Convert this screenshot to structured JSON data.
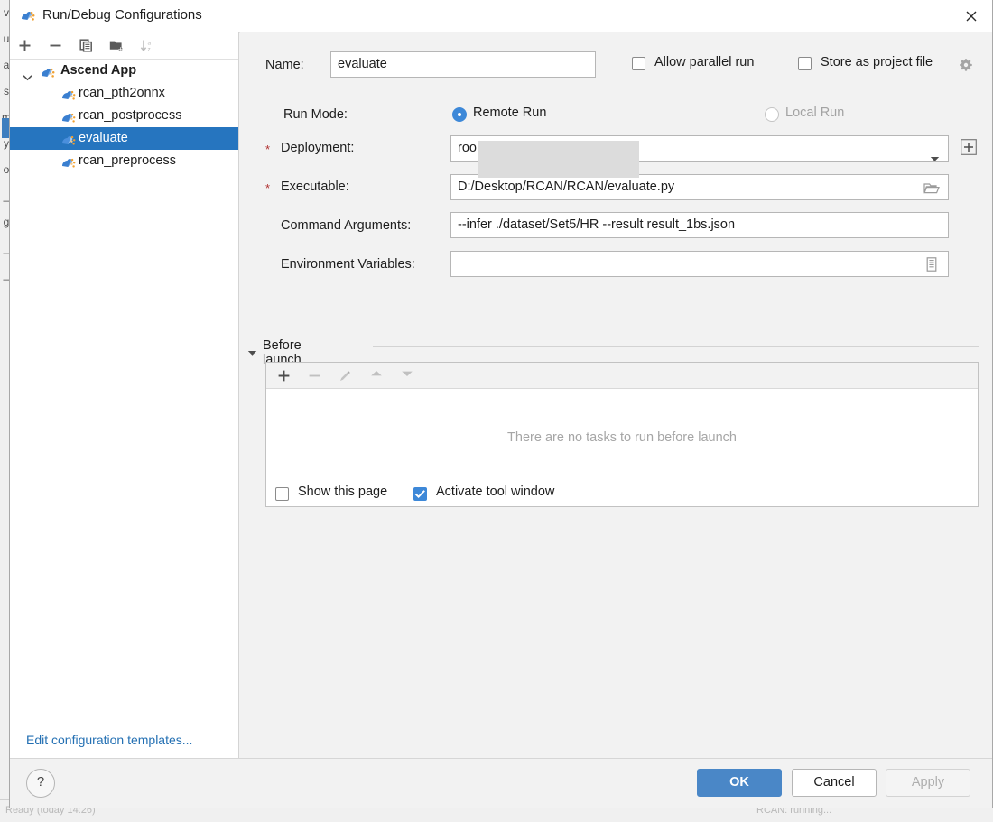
{
  "background": {
    "left_strip_chars": [
      "v",
      "u",
      "a",
      "s",
      "m",
      "y",
      "o",
      "_",
      "g",
      "_",
      "_"
    ],
    "status_left": "Ready (today 14:26)",
    "status_right": "RCAN: running..."
  },
  "dialog": {
    "title": "Run/Debug Configurations",
    "title_icon": "ascend-app-icon",
    "close_icon": "close-icon"
  },
  "sidebar": {
    "toolbar": [
      {
        "name": "add-configuration-button",
        "icon": "plus-icon",
        "enabled": true
      },
      {
        "name": "remove-configuration-button",
        "icon": "minus-icon",
        "enabled": true
      },
      {
        "name": "copy-configuration-button",
        "icon": "copy-icon",
        "enabled": true
      },
      {
        "name": "new-folder-button",
        "icon": "new-folder-icon",
        "enabled": true
      },
      {
        "name": "sort-configurations-button",
        "icon": "sort-alphabetical-icon",
        "enabled": false
      }
    ],
    "tree": {
      "group": {
        "label": "Ascend App",
        "expanded": true,
        "icon": "ascend-app-icon"
      },
      "children": [
        {
          "label": "rcan_pth2onnx",
          "selected": false,
          "icon": "ascend-app-icon"
        },
        {
          "label": "rcan_postprocess",
          "selected": false,
          "icon": "ascend-app-icon"
        },
        {
          "label": "evaluate",
          "selected": true,
          "icon": "ascend-app-icon"
        },
        {
          "label": "rcan_preprocess",
          "selected": false,
          "icon": "ascend-app-icon"
        }
      ]
    },
    "edit_templates_link": "Edit configuration templates..."
  },
  "form": {
    "name_label": "Name:",
    "name_value": "evaluate",
    "allow_parallel_run": {
      "label": "Allow parallel run",
      "checked": false
    },
    "store_as_project_file": {
      "label": "Store as project file",
      "checked": false,
      "gear_icon": "gear-dropdown-icon"
    },
    "run_mode_label": "Run Mode:",
    "remote_run": {
      "label": "Remote Run",
      "selected": true,
      "enabled": true
    },
    "local_run": {
      "label": "Local Run",
      "selected": false,
      "enabled": false
    },
    "deployment_label": "Deployment:",
    "deployment_value": "roo",
    "deployment_required": true,
    "deployment_add_icon": "add-box-icon",
    "executable_label": "Executable:",
    "executable_value": "D:/Desktop/RCAN/RCAN/evaluate.py",
    "executable_required": true,
    "executable_browse_icon": "folder-icon",
    "command_arguments_label": "Command Arguments:",
    "command_arguments_value": "--infer ./dataset/Set5/HR --result result_1bs.json",
    "environment_variables_label": "Environment Variables:",
    "environment_variables_value": "",
    "environment_variables_icon": "list-editor-icon"
  },
  "before_launch": {
    "title": "Before launch",
    "expanded": true,
    "toolbar": [
      {
        "name": "add-task-button",
        "icon": "plus-icon",
        "enabled": true
      },
      {
        "name": "remove-task-button",
        "icon": "minus-icon",
        "enabled": false
      },
      {
        "name": "edit-task-button",
        "icon": "pencil-icon",
        "enabled": false
      },
      {
        "name": "move-task-up-button",
        "icon": "arrow-up-icon",
        "enabled": false
      },
      {
        "name": "move-task-down-button",
        "icon": "arrow-down-icon",
        "enabled": false
      }
    ],
    "empty_message": "There are no tasks to run before launch",
    "show_this_page": {
      "label": "Show this page",
      "checked": false
    },
    "activate_tool_window": {
      "label": "Activate tool window",
      "checked": true
    }
  },
  "footer": {
    "help_label": "?",
    "ok_label": "OK",
    "cancel_label": "Cancel",
    "apply_label": "Apply",
    "apply_enabled": false
  },
  "colors": {
    "accent_blue": "#3d88d8",
    "selection_blue": "#2675bf",
    "primary_button": "#4a87c7",
    "link_blue": "#2470b3",
    "required_star": "#b03030",
    "redaction_gray": "#dcdcdc"
  }
}
